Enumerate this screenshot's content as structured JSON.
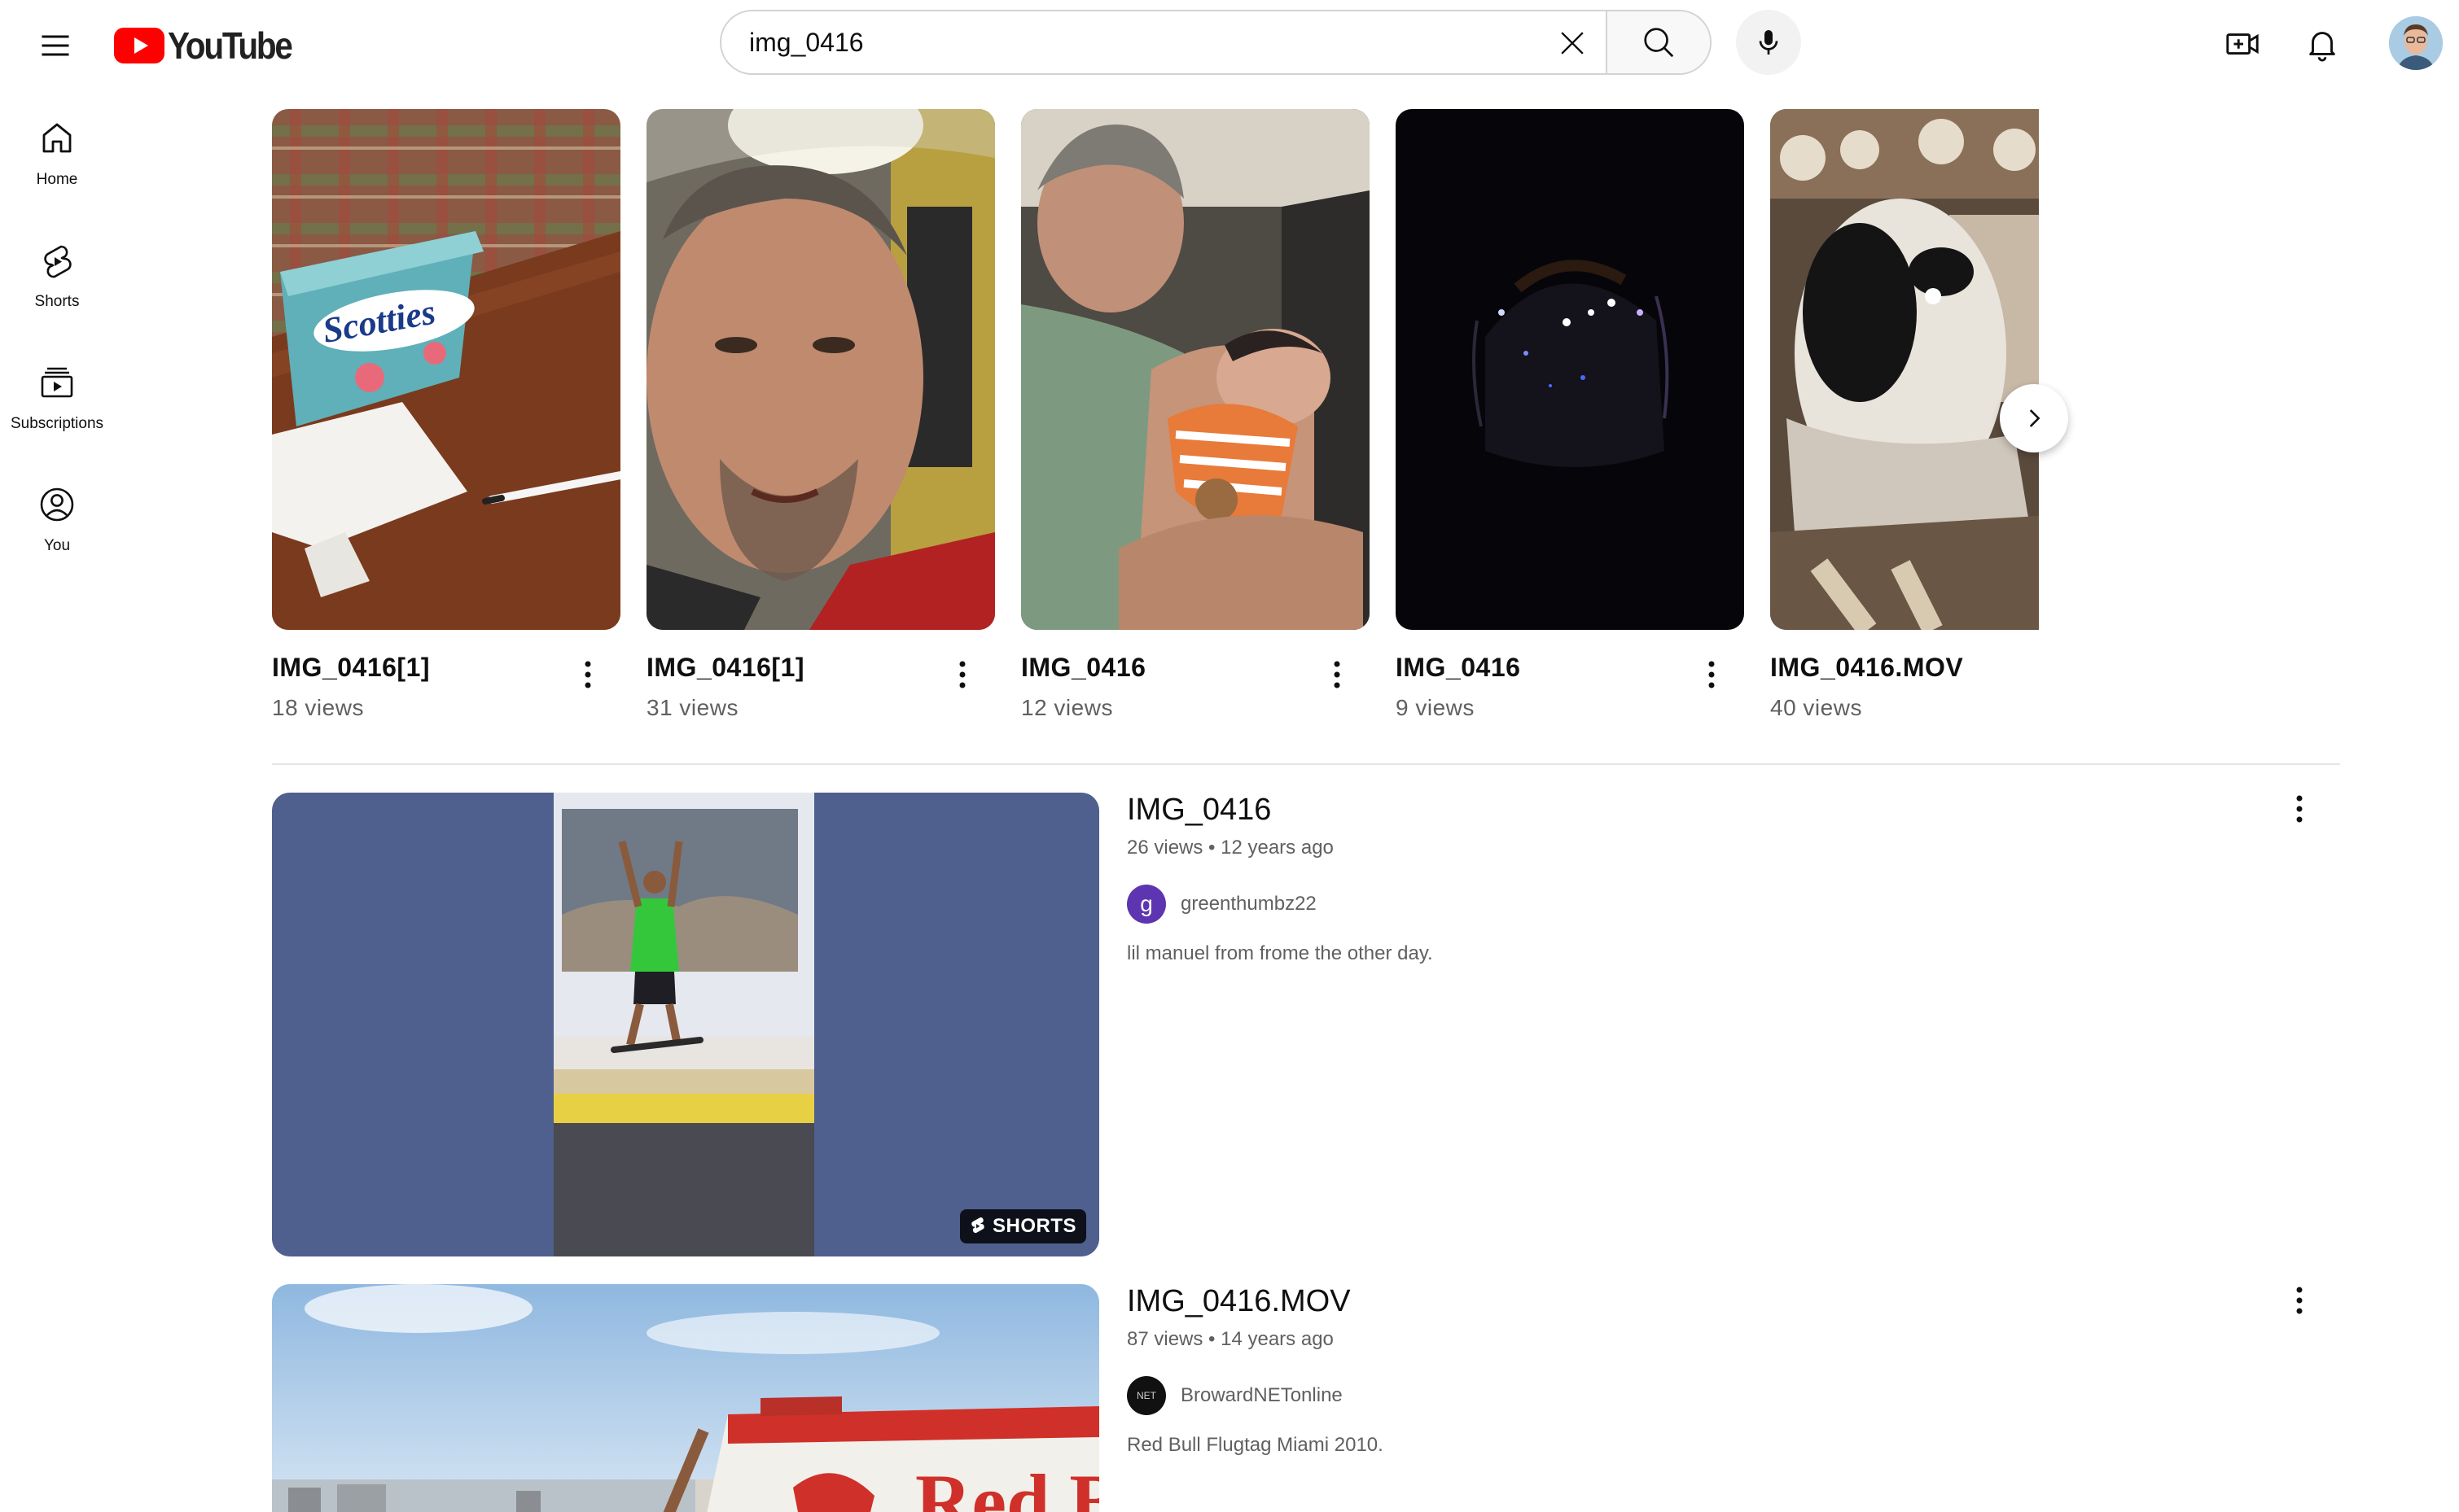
{
  "brand": {
    "name": "YouTube",
    "accent": "#ff0000"
  },
  "search": {
    "query": "img_0416",
    "placeholder": "Search"
  },
  "sidebar": {
    "items": [
      {
        "label": "Home",
        "icon": "home-icon"
      },
      {
        "label": "Shorts",
        "icon": "shorts-icon"
      },
      {
        "label": "Subscriptions",
        "icon": "subscriptions-icon"
      },
      {
        "label": "You",
        "icon": "you-icon"
      }
    ]
  },
  "shorts": [
    {
      "title": "IMG_0416[1]",
      "views": "18 views"
    },
    {
      "title": "IMG_0416[1]",
      "views": "31 views"
    },
    {
      "title": "IMG_0416",
      "views": "12 views"
    },
    {
      "title": "IMG_0416",
      "views": "9 views"
    },
    {
      "title": "IMG_0416.MOV",
      "views": "40 views"
    }
  ],
  "results": [
    {
      "title": "IMG_0416",
      "views": "26 views",
      "age": "12 years ago",
      "channel": "greenthumbz22",
      "channel_initial": "g",
      "channel_color": "#5e35b1",
      "description": "lil manuel from frome the other day.",
      "badge": "SHORTS"
    },
    {
      "title": "IMG_0416.MOV",
      "views": "87 views",
      "age": "14 years ago",
      "channel": "BrowardNETonline",
      "channel_avatar_text": "NET",
      "description": "Red Bull Flugtag Miami 2010.",
      "thumb_text": "Red B"
    }
  ]
}
